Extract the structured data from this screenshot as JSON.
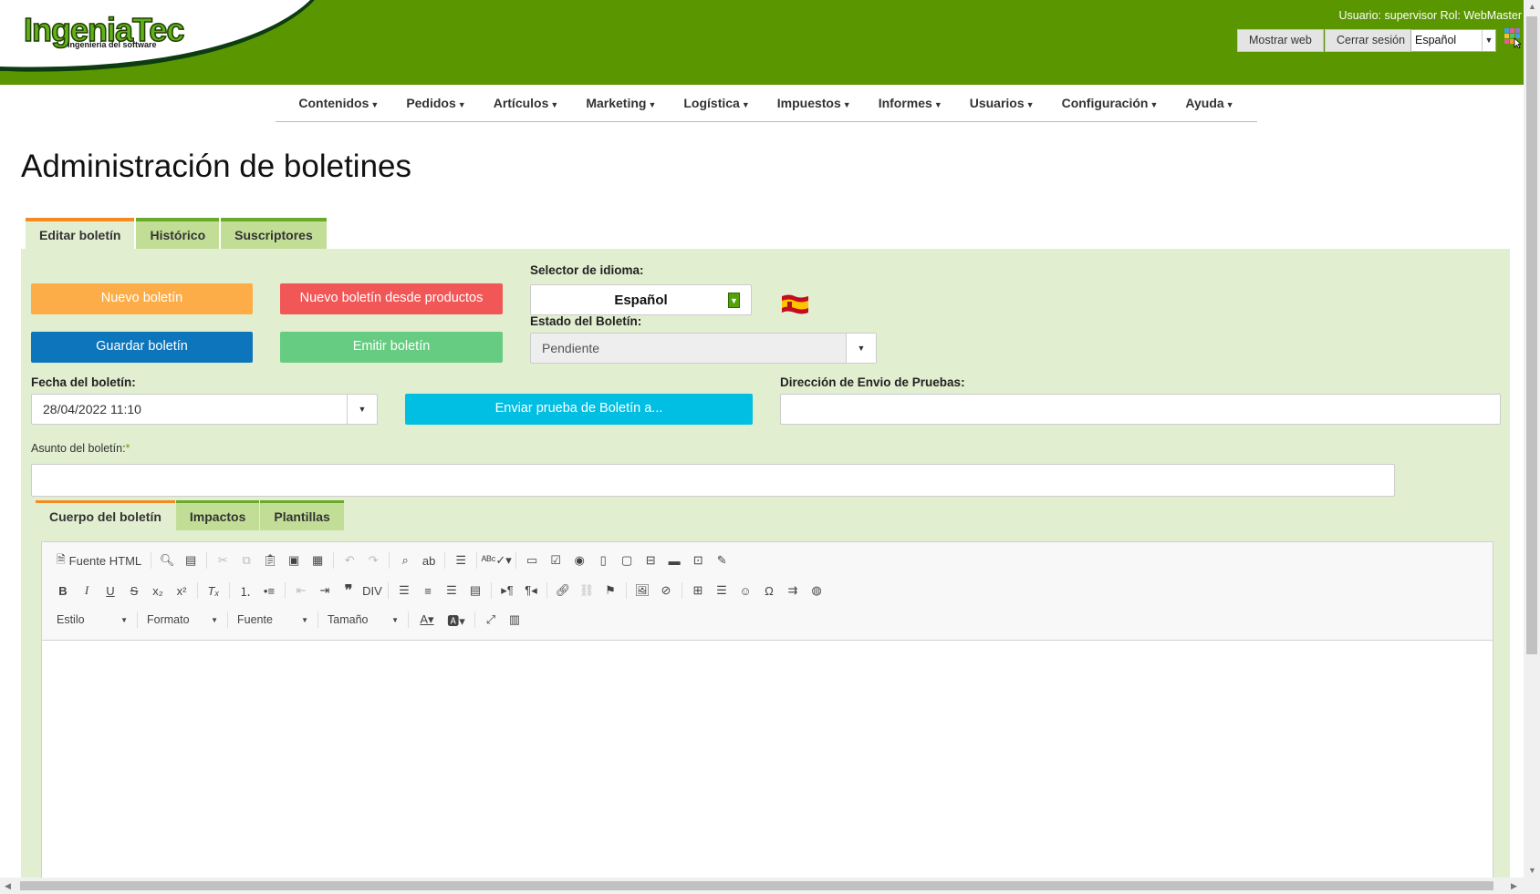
{
  "header": {
    "logo_text": "IngeniaTec",
    "logo_subtitle": "Ingeniería del software",
    "user_info": "Usuario: supervisor Rol: WebMaster",
    "show_web_label": "Mostrar web",
    "logout_label": "Cerrar sesión",
    "language_value": "Español",
    "brand_color": "#5a9600"
  },
  "nav": {
    "items": [
      "Contenidos",
      "Pedidos",
      "Artículos",
      "Marketing",
      "Logística",
      "Impuestos",
      "Informes",
      "Usuarios",
      "Configuración",
      "Ayuda"
    ]
  },
  "page": {
    "title": "Administración de boletines"
  },
  "tabs": {
    "items": [
      "Editar boletín",
      "Histórico",
      "Suscriptores"
    ],
    "active": "Editar boletín"
  },
  "form": {
    "new_button": "Nuevo boletín",
    "new_from_products_button": "Nuevo boletín desde productos",
    "save_button": "Guardar boletín",
    "emit_button": "Emitir boletín",
    "language_selector_label": "Selector de idioma:",
    "language_selector_value": "Español",
    "status_label": "Estado del Boletín:",
    "status_value": "Pendiente",
    "date_label": "Fecha del boletín:",
    "date_value": "28/04/2022 11:10",
    "send_test_button": "Enviar prueba de Boletín a...",
    "test_address_label": "Dirección de Envio de Pruebas:",
    "test_address_value": "",
    "subject_label": "Asunto del boletín:",
    "subject_required_mark": "*",
    "subject_value": ""
  },
  "editor_tabs": {
    "items": [
      "Cuerpo del boletín",
      "Impactos",
      "Plantillas"
    ],
    "active": "Cuerpo del boletín"
  },
  "editor": {
    "source_label": "Fuente HTML",
    "style_combo": "Estilo",
    "format_combo": "Formato",
    "font_combo": "Fuente",
    "size_combo": "Tamaño",
    "content": ""
  },
  "colors": {
    "orange": "#fdad47",
    "red": "#f25757",
    "blue": "#0d75bb",
    "green": "#66cc82",
    "cyan": "#00bfe3",
    "panel": "#e2eed0"
  }
}
